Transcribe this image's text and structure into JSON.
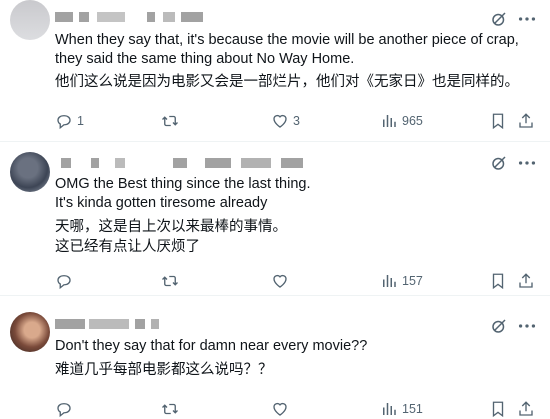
{
  "posts": [
    {
      "text": "When they say that, it's because the movie will be another piece of crap, they said the same thing about No Way Home.",
      "translation": "他们这么说是因为电影又会是一部烂片，他们对《无家日》也是同样的。",
      "replies": "1",
      "reposts": "",
      "likes": "3",
      "views": "965"
    },
    {
      "text": "OMG the Best thing since the last thing.\nIt's kinda gotten tiresome already",
      "translation": "天哪，这是自上次以来最棒的事情。\n这已经有点让人厌烦了",
      "replies": "",
      "reposts": "",
      "likes": "",
      "views": "157"
    },
    {
      "text": "Don't they say that for damn near every movie??",
      "translation": "难道几乎每部电影都这么说吗？？",
      "replies": "",
      "reposts": "",
      "likes": "",
      "views": "151"
    }
  ],
  "icons": {
    "reply": "reply-icon",
    "repost": "repost-icon",
    "like": "heart-icon",
    "views": "views-icon",
    "bookmark": "bookmark-icon",
    "share": "share-icon",
    "grok": "grok-icon",
    "more": "more-icon"
  },
  "colors": {
    "icon": "#536471",
    "divider": "#eff3f4",
    "text": "#0f1419"
  }
}
